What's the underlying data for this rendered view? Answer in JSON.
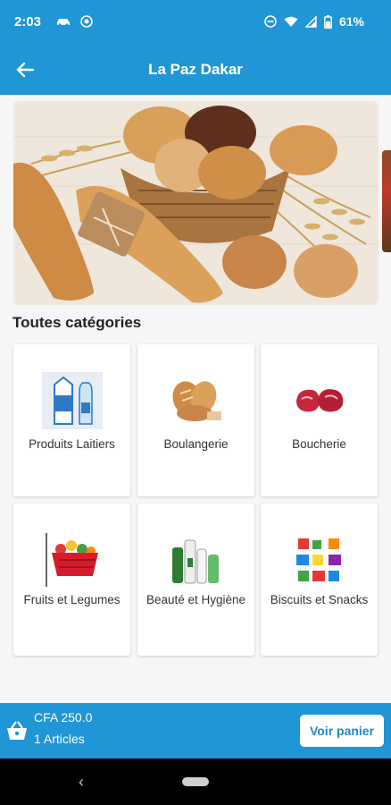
{
  "status_bar": {
    "time": "2:03",
    "battery": "61%"
  },
  "app_bar": {
    "title": "La Paz Dakar",
    "back_icon": "arrow-left-icon"
  },
  "banner": {
    "subject": "bread-basket-photo"
  },
  "categories_section": {
    "title": "Toutes catégories",
    "items": [
      {
        "label": "Produits Laitiers",
        "icon": "dairy-icon"
      },
      {
        "label": "Boulangerie",
        "icon": "bread-icon"
      },
      {
        "label": "Boucherie",
        "icon": "meat-icon"
      },
      {
        "label": "Fruits et Legumes",
        "icon": "fruit-basket-icon"
      },
      {
        "label": "Beauté et Hygiène",
        "icon": "cosmetics-icon"
      },
      {
        "label": "Biscuits et Snacks",
        "icon": "snacks-icon"
      }
    ]
  },
  "cart": {
    "price": "CFA 250.0",
    "count": "1 Articles",
    "button_label": "Voir panier"
  },
  "colors": {
    "primary": "#2196d6",
    "background": "#f6f6f6",
    "button_text": "#1e88c9"
  }
}
